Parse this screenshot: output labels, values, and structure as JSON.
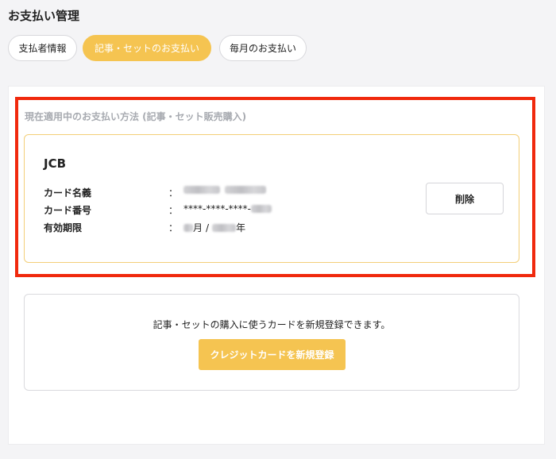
{
  "page": {
    "title": "お支払い管理"
  },
  "tabs": [
    {
      "label": "支払者情報",
      "active": false
    },
    {
      "label": "記事・セットのお支払い",
      "active": true
    },
    {
      "label": "毎月のお支払い",
      "active": false
    }
  ],
  "current_method": {
    "heading": "現在適用中のお支払い方法 (記事・セット販売購入)",
    "brand": "JCB",
    "fields": [
      {
        "label": "カード名義",
        "separator": "：",
        "value_visible": "",
        "redacted": true
      },
      {
        "label": "カード番号",
        "separator": "：",
        "value_visible": "****-****-****-",
        "redacted": true
      },
      {
        "label": "有効期限",
        "separator": "：",
        "month_suffix": "月",
        "slash": "/",
        "year_suffix": "年",
        "redacted": true
      }
    ],
    "delete_label": "削除"
  },
  "register": {
    "text": "記事・セットの購入に使うカードを新規登録できます。",
    "button_label": "クレジットカードを新規登録"
  },
  "colors": {
    "accent": "#f5c451",
    "highlight_border": "#f0290d",
    "card_border": "#f3cf78",
    "muted_heading": "#a7aab0"
  }
}
